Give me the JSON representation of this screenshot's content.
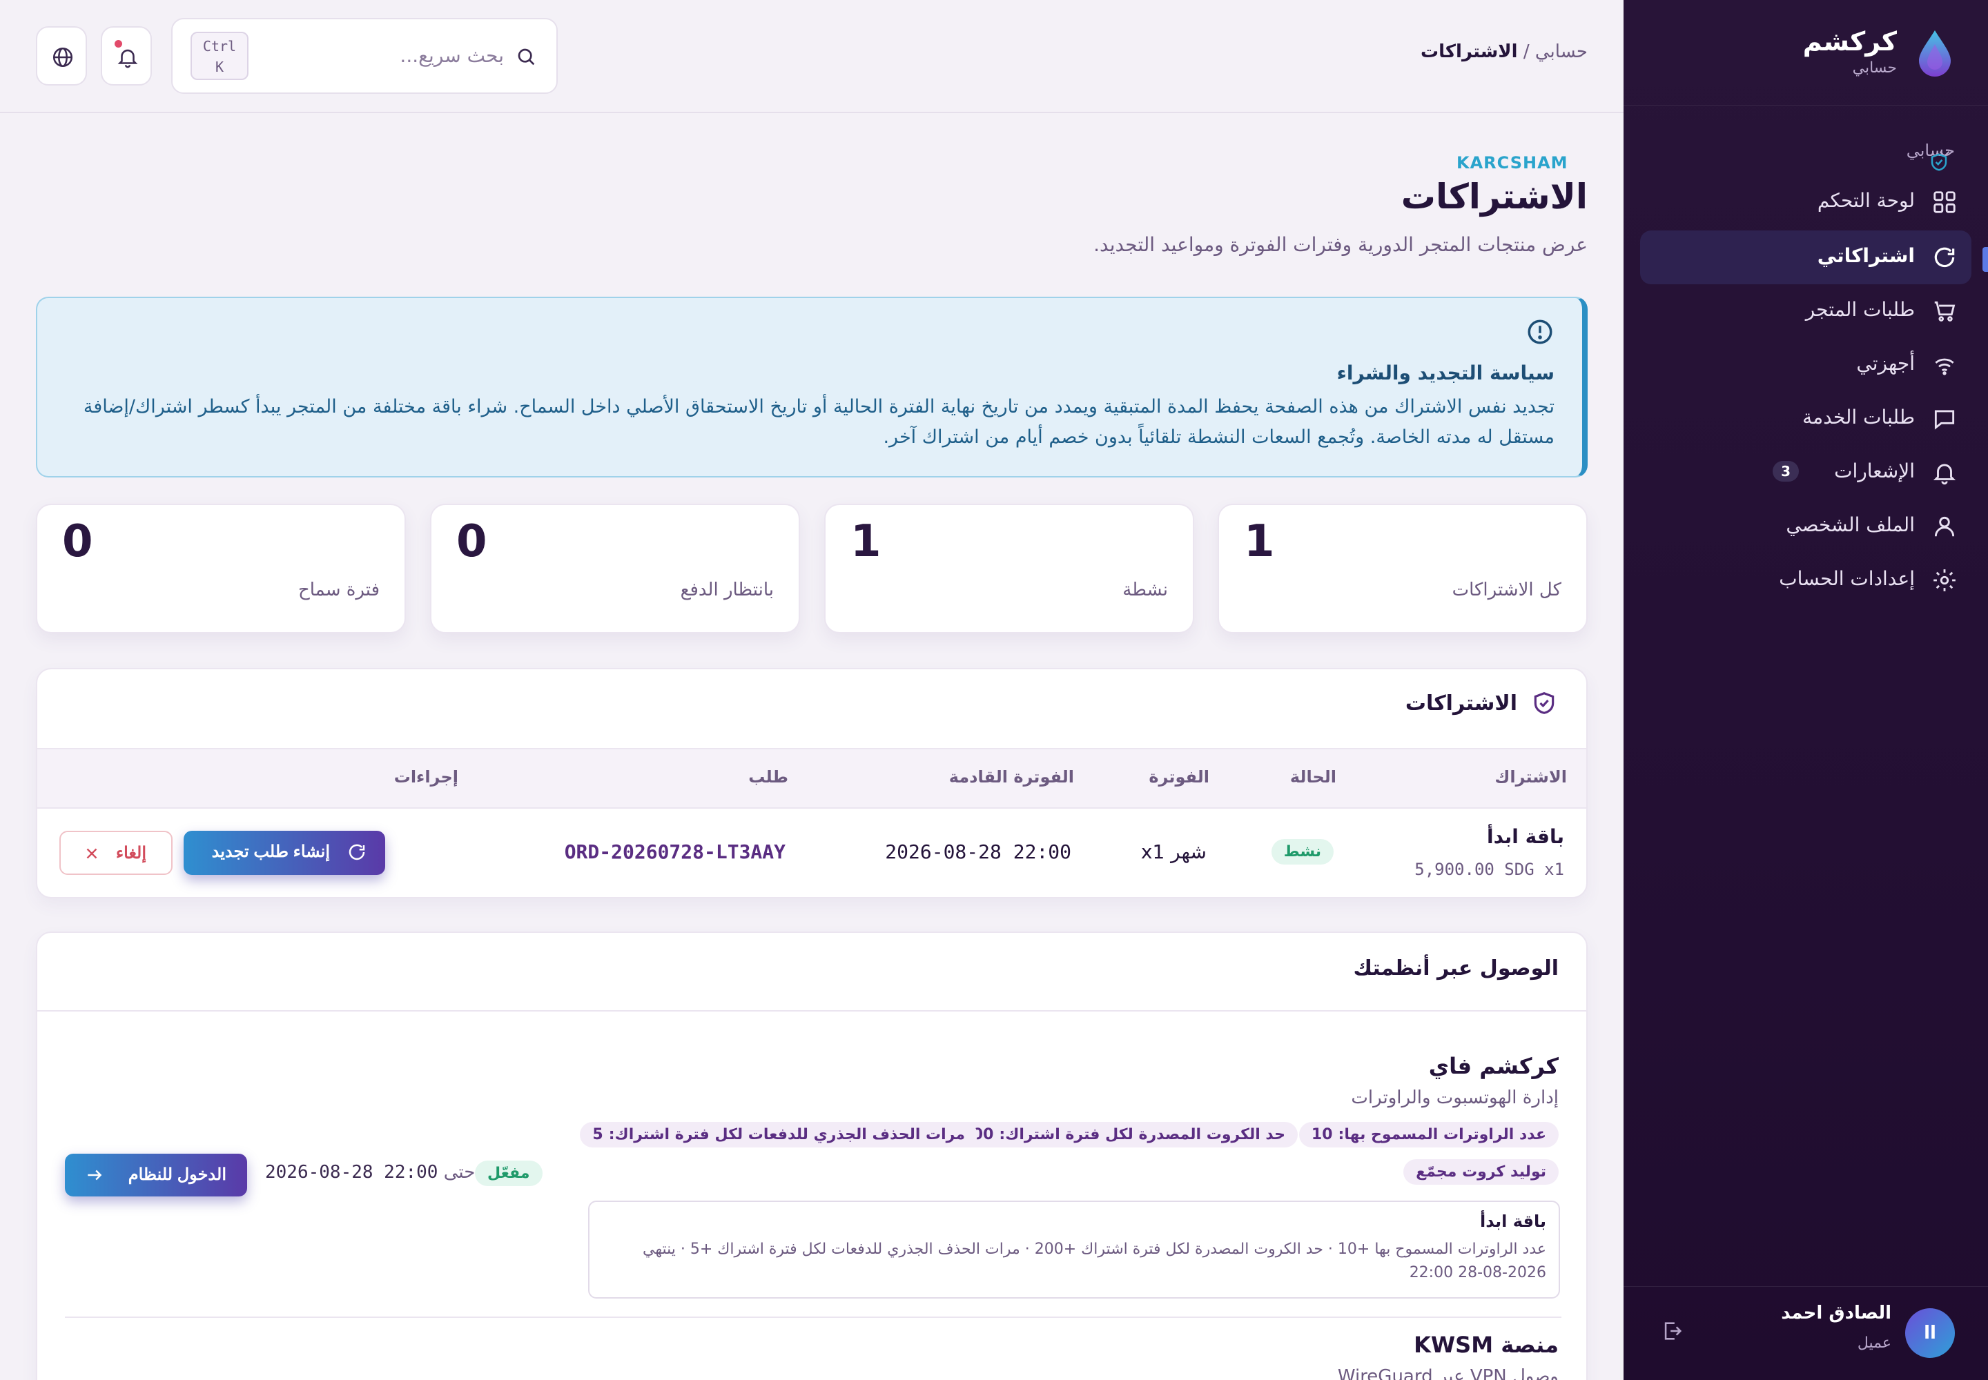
{
  "sidebar": {
    "brand_name": "كركشم",
    "brand_sub": "حسابي",
    "section_label": "حسابي",
    "items": [
      {
        "label": "لوحة التحكم",
        "icon": "grid-icon"
      },
      {
        "label": "اشتراكاتي",
        "icon": "refresh-icon",
        "active": true
      },
      {
        "label": "طلبات المتجر",
        "icon": "cart-icon"
      },
      {
        "label": "أجهزتي",
        "icon": "wifi-icon"
      },
      {
        "label": "طلبات الخدمة",
        "icon": "chat-icon"
      },
      {
        "label": "الإشعارات",
        "icon": "bell-icon",
        "badge": "3"
      },
      {
        "label": "الملف الشخصي",
        "icon": "user-icon"
      },
      {
        "label": "إعدادات الحساب",
        "icon": "gear-icon"
      }
    ],
    "user": {
      "initials": "اا",
      "name": "الصادق احمد",
      "role": "عميل"
    }
  },
  "topbar": {
    "breadcrumb_root": "حسابي",
    "breadcrumb_sep": " / ",
    "breadcrumb_current": "الاشتراكات",
    "search_placeholder": "بحث سريع...",
    "kbd_ctrl": "Ctrl",
    "kbd_k": "K"
  },
  "header": {
    "brand_tag": "KARCSHAM",
    "title": "الاشتراكات",
    "description": "عرض منتجات المتجر الدورية وفترات الفوترة ومواعيد التجديد."
  },
  "policy": {
    "title": "سياسة التجديد والشراء",
    "body": "تجديد نفس الاشتراك من هذه الصفحة يحفظ المدة المتبقية ويمدد من تاريخ نهاية الفترة الحالية أو تاريخ الاستحقاق الأصلي داخل السماح. شراء باقة مختلفة من المتجر يبدأ كسطر اشتراك/إضافة مستقل له مدته الخاصة. وتُجمع السعات النشطة تلقائياً بدون خصم أيام من اشتراك آخر."
  },
  "stats": [
    {
      "label": "كل الاشتراكات",
      "value": "1"
    },
    {
      "label": "نشطة",
      "value": "1"
    },
    {
      "label": "بانتظار الدفع",
      "value": "0"
    },
    {
      "label": "فترة سماح",
      "value": "0"
    }
  ],
  "subscriptions": {
    "title": "الاشتراكات",
    "columns": [
      "الاشتراك",
      "الحالة",
      "الفوترة",
      "الفوترة القادمة",
      "طلب",
      "إجراءات"
    ],
    "rows": [
      {
        "name": "باقة ابدأ",
        "price": "5,900.00 SDG x1",
        "status": "نشط",
        "billing": "شهر x1",
        "next_billing": "2026-08-28 22:00",
        "order": "ORD-20260728-LT3AAY",
        "renew_label": "إنشاء طلب تجديد",
        "cancel_label": "إلغاء"
      }
    ]
  },
  "access": {
    "title": "الوصول عبر أنظمتك",
    "systems": [
      {
        "name": "كركشم فاي",
        "description": "إدارة الهوتسبوت والراوترات",
        "features": [
          {
            "label": "عدد الراوترات المسموح بها:",
            "value": "10"
          },
          {
            "label": "حد الكروت المصدرة لكل فترة اشتراك:",
            "value": "200"
          },
          {
            "label": "مرات الحذف الجذري للدفعات لكل فترة اشتراك:",
            "value": "5"
          },
          {
            "label": "توليد كروت مجمّع",
            "value": ""
          }
        ],
        "status": "مفعّل",
        "until_label": "حتى",
        "until_value": "2026-08-28 22:00",
        "login_label": "الدخول للنظام",
        "plan_title": "باقة ابدأ",
        "plan_detail": "عدد الراوترات المسموح بها +10 · حد الكروت المصدرة لكل فترة اشتراك +200 · مرات الحذف الجذري للدفعات لكل فترة اشتراك +5 · ينتهي 2026-08-28 22:00"
      },
      {
        "name": "منصة KWSM",
        "description": "وصول VPN عبر WireGuard"
      }
    ]
  },
  "colors": {
    "sidebar_bg": "#281438",
    "accent_blue": "#2f8fd0",
    "accent_purple": "#5a3aa8",
    "success": "#1f9a6a",
    "danger": "#d24b5b",
    "info": "#2aa4cc"
  }
}
